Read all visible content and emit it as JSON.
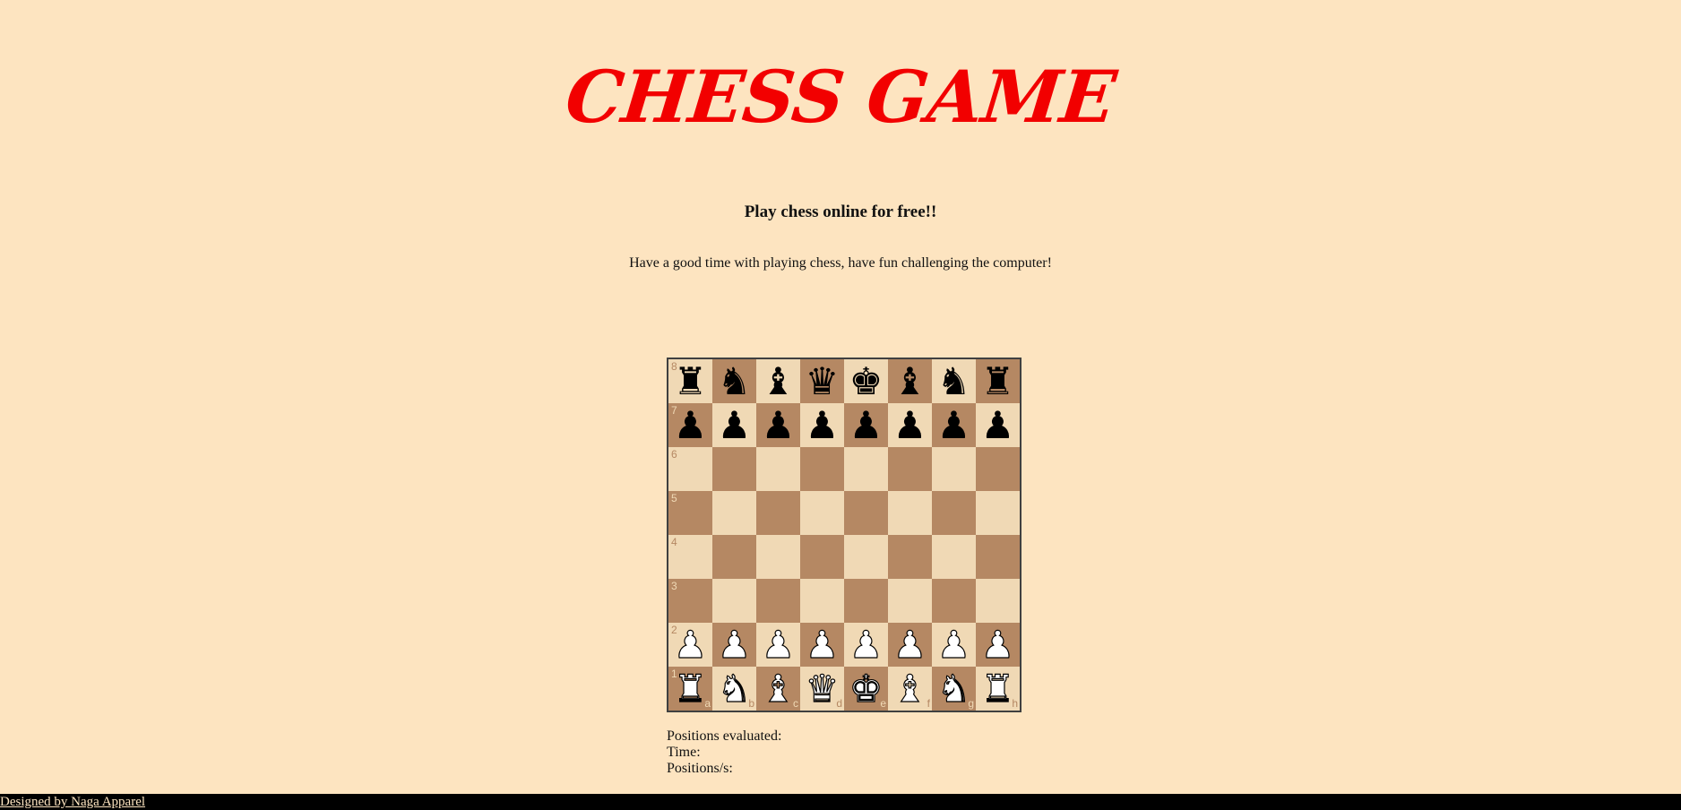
{
  "header": {
    "title": "CHESS GAME",
    "subtitle": "Play chess online for free!!",
    "description": "Have a good time with playing chess, have fun challenging the computer!"
  },
  "board": {
    "light_color": "#f0d9b5",
    "dark_color": "#b58863",
    "ranks": [
      "8",
      "7",
      "6",
      "5",
      "4",
      "3",
      "2",
      "1"
    ],
    "files": [
      "a",
      "b",
      "c",
      "d",
      "e",
      "f",
      "g",
      "h"
    ],
    "rows": [
      [
        "bR",
        "bN",
        "bB",
        "bQ",
        "bK",
        "bB",
        "bN",
        "bR"
      ],
      [
        "bP",
        "bP",
        "bP",
        "bP",
        "bP",
        "bP",
        "bP",
        "bP"
      ],
      [
        "",
        "",
        "",
        "",
        "",
        "",
        "",
        ""
      ],
      [
        "",
        "",
        "",
        "",
        "",
        "",
        "",
        ""
      ],
      [
        "",
        "",
        "",
        "",
        "",
        "",
        "",
        ""
      ],
      [
        "",
        "",
        "",
        "",
        "",
        "",
        "",
        ""
      ],
      [
        "wP",
        "wP",
        "wP",
        "wP",
        "wP",
        "wP",
        "wP",
        "wP"
      ],
      [
        "wR",
        "wN",
        "wB",
        "wQ",
        "wK",
        "wB",
        "wN",
        "wR"
      ]
    ]
  },
  "stats": {
    "positions_evaluated_label": "Positions evaluated:",
    "positions_evaluated_value": "",
    "time_label": "Time:",
    "time_value": "",
    "positions_per_sec_label": "Positions/s:",
    "positions_per_sec_value": ""
  },
  "footer": {
    "credit": "Designed by Naga Apparel"
  },
  "colors": {
    "background": "#fde4c0",
    "title": "#f20000"
  }
}
